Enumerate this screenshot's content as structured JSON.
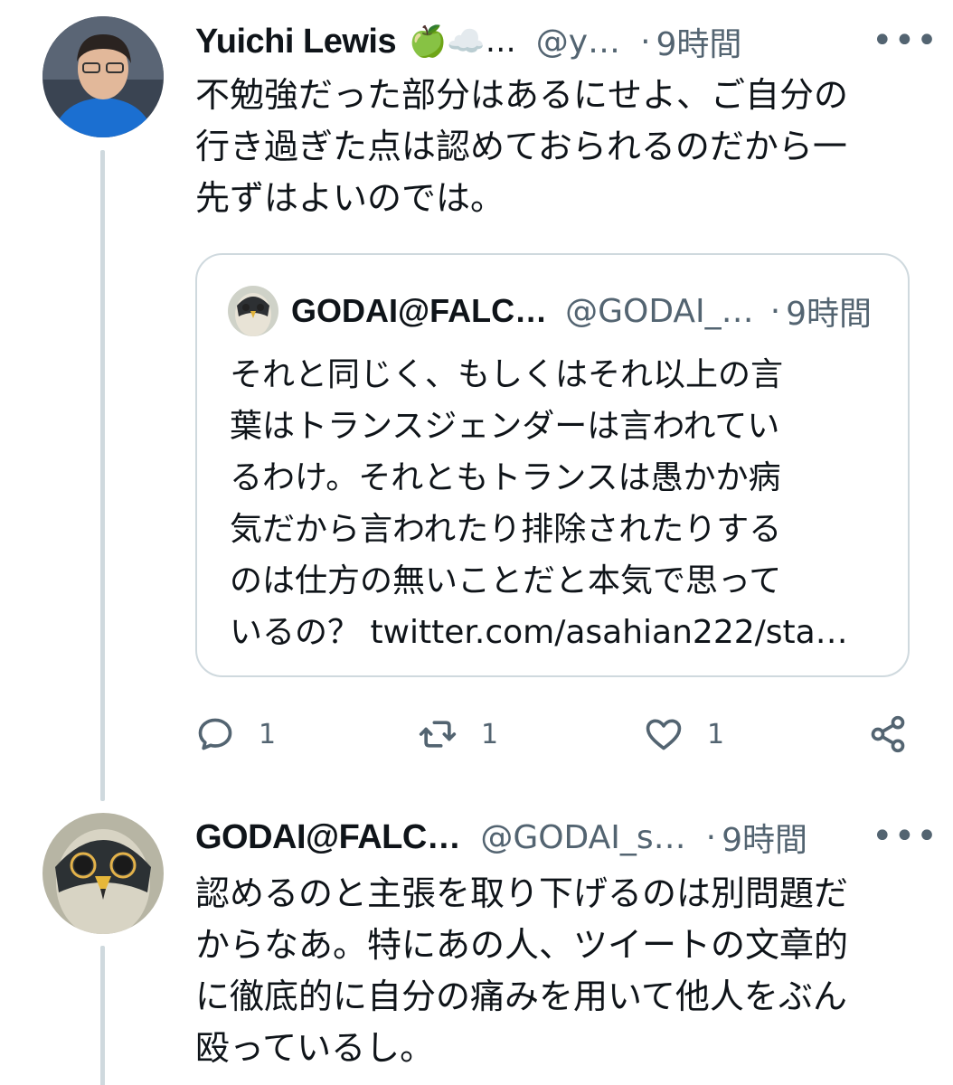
{
  "tweet1": {
    "name": "Yuichi Lewis",
    "emojis": "🍏☁️…",
    "handle": "@y…",
    "dot": "·",
    "time": "9時間",
    "more": "•••",
    "lines": [
      "不勉強だった部分はあるにせよ、ご自分の",
      "行き過ぎた点は認めておられるのだから一",
      "先ずはよいのでは。"
    ]
  },
  "quote": {
    "name": "GODAI@FALC…",
    "handle": "@GODAI_…",
    "dot": "·",
    "time": "9時間",
    "lines": [
      "それと同じく、もしくはそれ以上の言",
      "葉はトランスジェンダーは言われてい",
      "るわけ。それともトランスは愚かか病",
      "気だから言われたり排除されたりする",
      "のは仕方の無いことだと本気で思って",
      "いるの？ twitter.com/asahian222/sta…"
    ]
  },
  "actions": {
    "reply_count": "1",
    "retweet_count": "1",
    "like_count": "1"
  },
  "tweet2": {
    "name": "GODAI@FALC…",
    "handle": "@GODAI_s…",
    "dot": "·",
    "time": "9時間",
    "more": "•••",
    "lines": [
      "認めるのと主張を取り下げるのは別問題だ",
      "からなあ。特にあの人、ツイートの文章的",
      "に徹底的に自分の痛みを用いて他人をぶん",
      "殴っているし。"
    ]
  },
  "colors": {
    "text": "#0f1419",
    "secondary": "#536471",
    "border": "#cfd9de"
  },
  "icons": [
    "reply-icon",
    "retweet-icon",
    "like-icon",
    "share-icon",
    "more-icon"
  ]
}
